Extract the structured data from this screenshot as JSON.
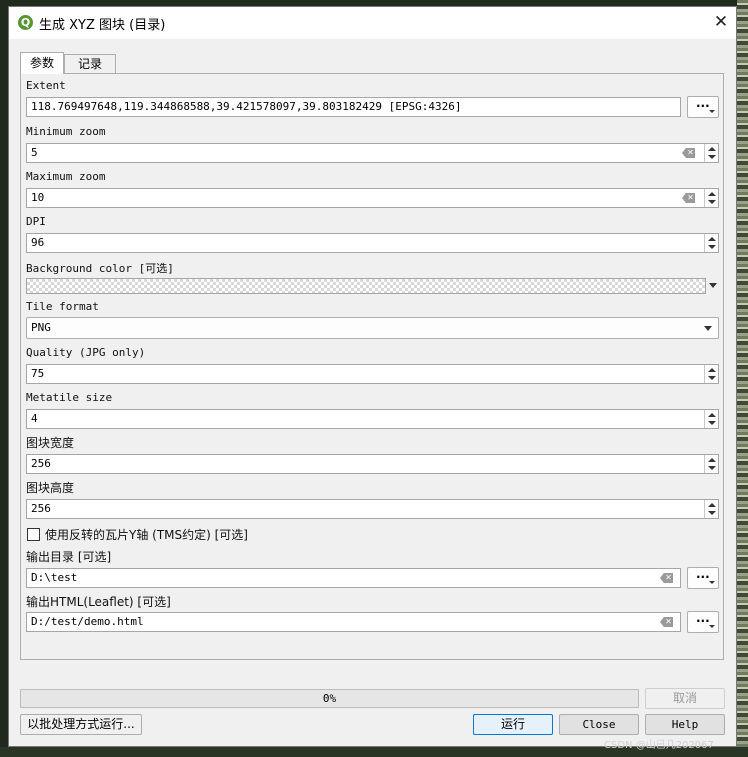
{
  "window": {
    "title": "生成 XYZ 图块 (目录)"
  },
  "tabs": [
    {
      "label": "参数"
    },
    {
      "label": "记录"
    }
  ],
  "extent": {
    "label": "Extent",
    "value": "118.769497648,119.344868588,39.421578097,39.803182429 [EPSG:4326]"
  },
  "min_zoom": {
    "label": "Minimum zoom",
    "value": "5"
  },
  "max_zoom": {
    "label": "Maximum zoom",
    "value": "10"
  },
  "dpi": {
    "label": "DPI",
    "value": "96"
  },
  "background_color": {
    "label": "Background color [可选]"
  },
  "tile_format": {
    "label": "Tile format",
    "value": "PNG"
  },
  "quality": {
    "label": "Quality (JPG only)",
    "value": "75"
  },
  "metatile_size": {
    "label": "Metatile size",
    "value": "4"
  },
  "tile_width": {
    "label": "图块宽度",
    "value": "256"
  },
  "tile_height": {
    "label": "图块高度",
    "value": "256"
  },
  "inverted_y": {
    "label": "使用反转的瓦片Y轴 (TMS约定) [可选]",
    "checked": false
  },
  "output_dir": {
    "label": "输出目录 [可选]",
    "value": "D:\\test"
  },
  "output_html": {
    "label": "输出HTML(Leaflet) [可选]",
    "value": "D:/test/demo.html"
  },
  "progress": {
    "text": "0%",
    "fraction": 0
  },
  "buttons": {
    "cancel": "取消",
    "batch": "以批处理方式运行...",
    "run": "运行",
    "close": "Close",
    "help": "Help"
  },
  "watermark": "CSDN @山已几202067",
  "icons": {
    "app": "qgis-icon",
    "close": "close-icon",
    "clear": "clear-text-icon",
    "more": "ellipsis-icon"
  }
}
